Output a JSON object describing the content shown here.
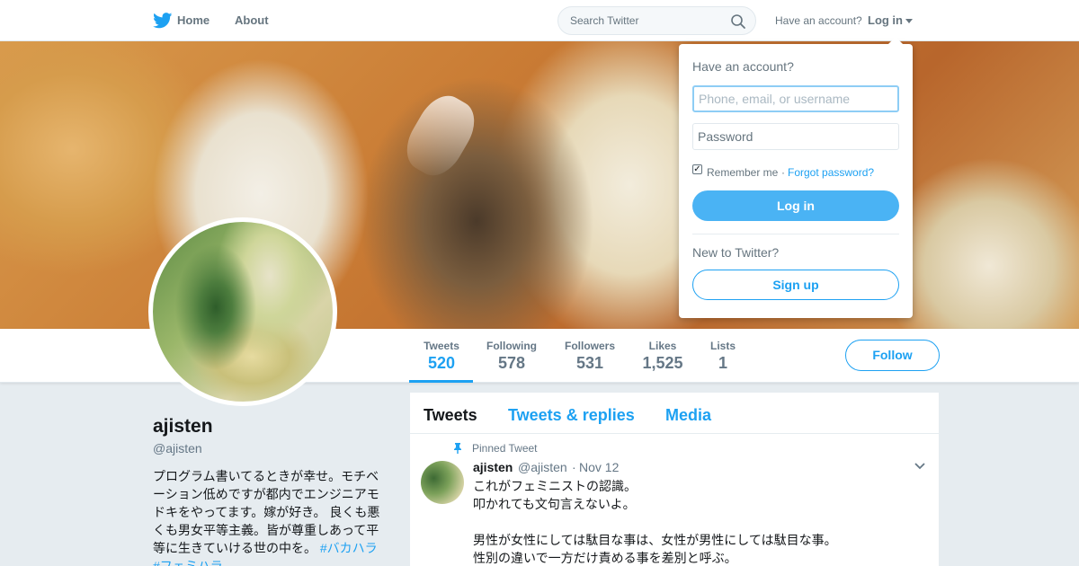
{
  "topbar": {
    "home_label": "Home",
    "about_label": "About",
    "search_placeholder": "Search Twitter",
    "have_account": "Have an account?",
    "login_label": "Log in"
  },
  "profile": {
    "name": "ajisten",
    "handle": "@ajisten",
    "bio_lines": [
      "プログラム書いてるときが幸せ。モチベ",
      "ーション低めですが都内でエンジニアモ",
      "ドキをやってます。嫁が好き。 良くも悪",
      "くも男女平等主義。皆が尊重しあって平",
      "等に生きていける世の中を。"
    ],
    "bio_tag_1": "#バカハラ",
    "bio_tag_2": "#フェミハラ"
  },
  "stats": [
    {
      "label": "Tweets",
      "value": "520"
    },
    {
      "label": "Following",
      "value": "578"
    },
    {
      "label": "Followers",
      "value": "531"
    },
    {
      "label": "Likes",
      "value": "1,525"
    },
    {
      "label": "Lists",
      "value": "1"
    }
  ],
  "follow_label": "Follow",
  "timeline": {
    "tabs": [
      "Tweets",
      "Tweets & replies",
      "Media"
    ],
    "pinned_label": "Pinned Tweet",
    "tweet": {
      "name": "ajisten",
      "handle": "@ajisten",
      "separator": "·",
      "date": "Nov 12",
      "lines": [
        "これがフェミニストの認識。",
        "叩かれても文句言えないよ。",
        "",
        "男性が女性にしては駄目な事は、女性が男性にしては駄目な事。",
        "性別の違いで一方だけ責める事を差別と呼ぶ。"
      ]
    }
  },
  "login_dropdown": {
    "heading": "Have an account?",
    "username_placeholder": "Phone, email, or username",
    "password_placeholder": "Password",
    "remember_label": "Remember me",
    "separator": "·",
    "forgot_label": "Forgot password?",
    "login_button": "Log in",
    "new_label": "New to Twitter?",
    "signup_button": "Sign up"
  },
  "colors": {
    "accent": "#1da1f2",
    "login_button": "#4ab3f4",
    "text_muted": "#657786",
    "background": "#e6ecf0"
  },
  "icons": [
    "twitter-bird-icon",
    "search-icon",
    "caret-down-icon",
    "pin-icon",
    "chevron-down-icon"
  ]
}
